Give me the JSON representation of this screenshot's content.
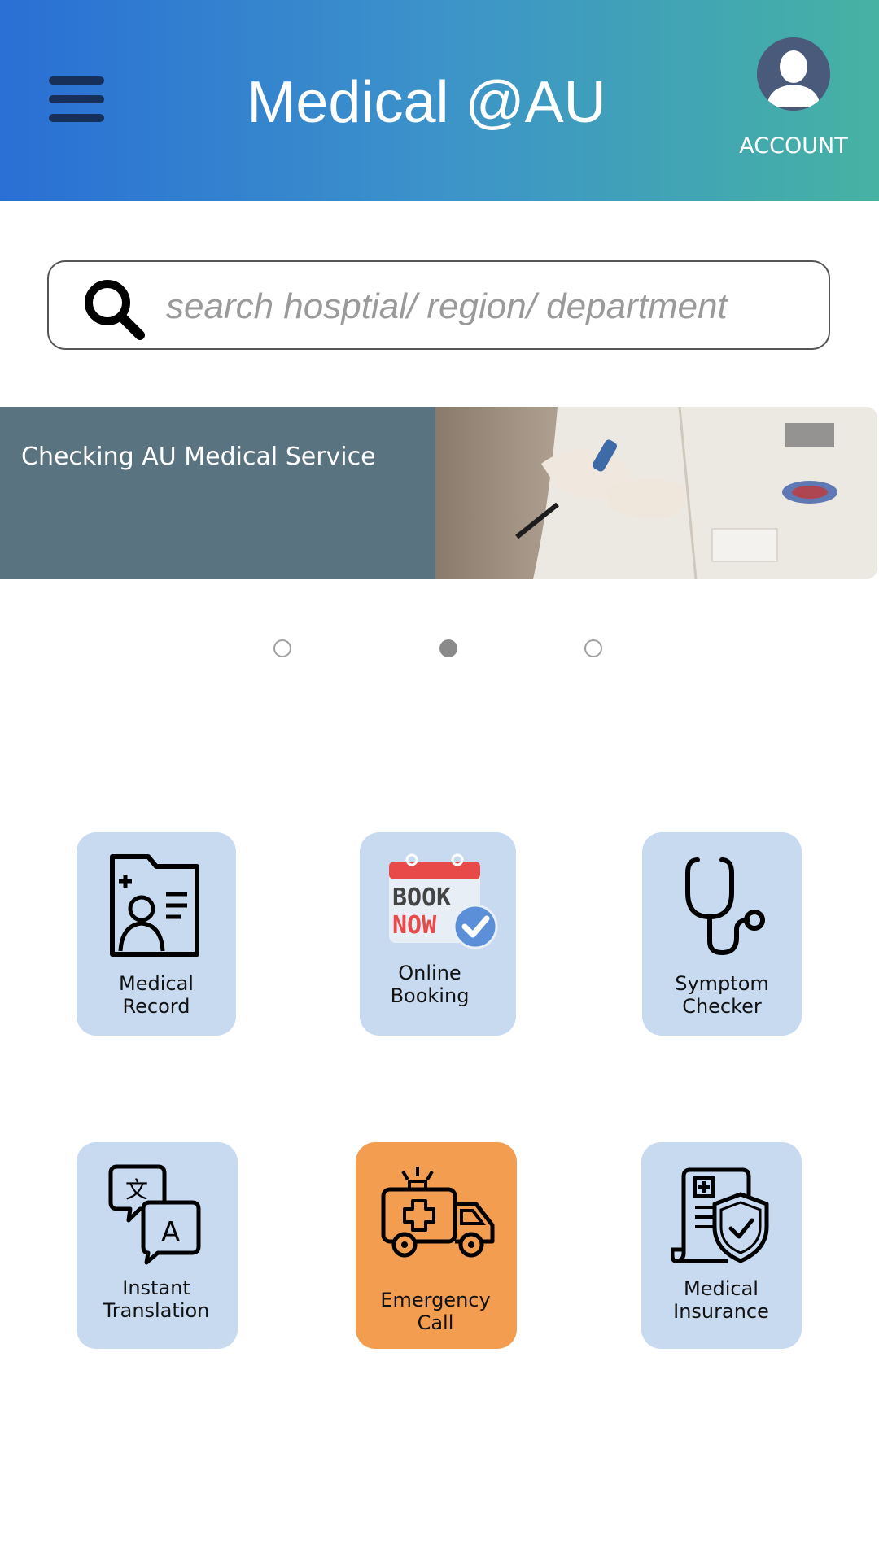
{
  "header": {
    "title": "Medical @AU",
    "account_label": "ACCOUNT",
    "menu_icon": "hamburger-menu-icon",
    "avatar_icon": "user-avatar-icon"
  },
  "search": {
    "placeholder": "search hosptial/ region/ department",
    "icon": "search-icon"
  },
  "banner": {
    "text": "Checking AU Medical Service"
  },
  "carousel": {
    "dots": 3,
    "active_index": 1
  },
  "tiles": [
    {
      "line1": "Medical",
      "line2": "Record",
      "icon": "medical-record-icon"
    },
    {
      "line1": "Online",
      "line2": "Booking",
      "icon": "book-now-calendar-icon",
      "icon_text_top": "BOOK",
      "icon_text_bottom": "NOW"
    },
    {
      "line1": "Symptom",
      "line2": "Checker",
      "icon": "stethoscope-icon"
    },
    {
      "line1": "Instant",
      "line2": "Translation",
      "icon": "translation-icon"
    },
    {
      "line1": "Emergency",
      "line2": "Call",
      "icon": "ambulance-icon"
    },
    {
      "line1": "Medical",
      "line2": "Insurance",
      "icon": "insurance-shield-icon"
    }
  ],
  "colors": {
    "header_gradient_start": "#2a6fd5",
    "header_gradient_end": "#46b2a3",
    "tile_background": "#c8daf0",
    "emergency_tile_background": "#f29d4f",
    "banner_panel": "#5a7380"
  }
}
